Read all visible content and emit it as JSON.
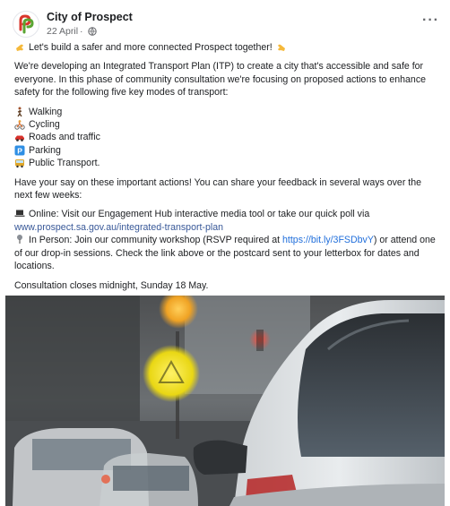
{
  "post": {
    "page_name": "City of Prospect",
    "date": "22 April",
    "separator": "·",
    "more_label": "···",
    "headline": "Let's build a safer and more connected Prospect together!",
    "intro": "We're developing an Integrated Transport Plan (ITP) to create a city that's accessible and safe for everyone. In this phase of community consultation we're focusing on proposed actions to enhance safety for the following five key modes of transport:",
    "modes": [
      {
        "icon": "walking-icon",
        "label": "Walking"
      },
      {
        "icon": "cycling-icon",
        "label": "Cycling"
      },
      {
        "icon": "car-icon",
        "label": "Roads and traffic"
      },
      {
        "icon": "parking-icon",
        "label": "Parking"
      },
      {
        "icon": "bus-icon",
        "label": "Public Transport."
      }
    ],
    "feedback_intro": "Have your say on these important actions! You can share your feedback in several ways over the next few weeks:",
    "online_text": "Online: Visit our Engagement Hub interactive media tool or take our quick poll via",
    "online_link": "www.prospect.sa.gov.au/integrated-transport-plan",
    "in_person_prefix": "In Person: Join our community workshop (RSVP required at",
    "in_person_link": "https://bit.ly/3FSDbvY",
    "in_person_suffix": ") or attend one of our drop-in sessions. Check the link above or the postcard sent to your letterbox for dates and locations.",
    "closing": "Consultation closes midnight, Sunday 18 May."
  },
  "colors": {
    "link": "#216fdb",
    "secondary_text": "#65676b",
    "logo_green": "#5aa532",
    "logo_red": "#d9362b"
  }
}
